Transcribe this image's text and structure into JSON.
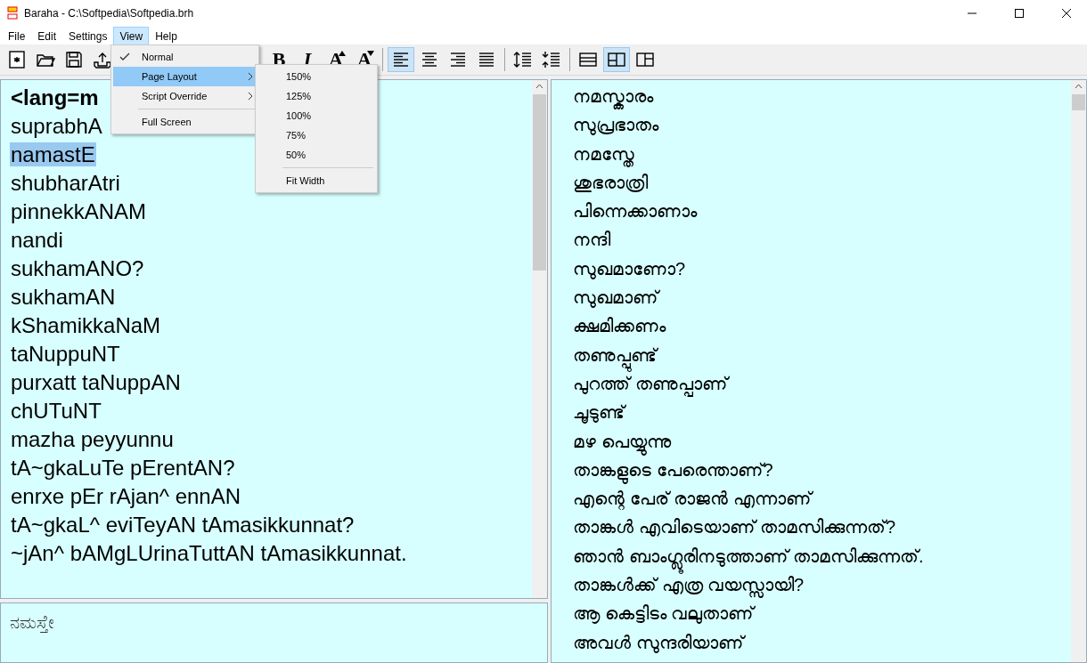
{
  "window": {
    "title": "Baraha - C:\\Softpedia\\Softpedia.brh"
  },
  "menu_bar": [
    {
      "label": "File",
      "selected": false
    },
    {
      "label": "Edit",
      "selected": false
    },
    {
      "label": "Settings",
      "selected": false
    },
    {
      "label": "View",
      "selected": true
    },
    {
      "label": "Help",
      "selected": false
    }
  ],
  "toolbar": [
    {
      "kind": "new",
      "selected": false
    },
    {
      "kind": "open",
      "selected": false
    },
    {
      "kind": "save",
      "selected": false
    },
    {
      "kind": "upload",
      "selected": false
    },
    {
      "kind": "gap"
    },
    {
      "kind": "bold",
      "label": "B",
      "selected": false
    },
    {
      "kind": "italic",
      "label": "I",
      "selected": false
    },
    {
      "kind": "grow",
      "label": "A",
      "selected": false
    },
    {
      "kind": "shrink",
      "label": "A",
      "selected": false
    },
    {
      "kind": "separator"
    },
    {
      "kind": "align-left",
      "selected": true
    },
    {
      "kind": "align-center",
      "selected": false
    },
    {
      "kind": "align-right",
      "selected": false
    },
    {
      "kind": "justify",
      "selected": false
    },
    {
      "kind": "separator"
    },
    {
      "kind": "spacing-up",
      "selected": false
    },
    {
      "kind": "spacing-down",
      "selected": false
    },
    {
      "kind": "separator"
    },
    {
      "kind": "layout-rows",
      "selected": false
    },
    {
      "kind": "layout-split",
      "selected": true
    },
    {
      "kind": "layout-columns",
      "selected": false
    }
  ],
  "view_menu": {
    "items": [
      {
        "label": "Normal",
        "checked": true,
        "selected": false,
        "submenu": false
      },
      {
        "label": "Page Layout",
        "checked": false,
        "selected": true,
        "submenu": true
      },
      {
        "label": "Script Override",
        "checked": false,
        "selected": false,
        "submenu": true
      },
      {
        "kind": "separator"
      },
      {
        "label": "Full Screen",
        "checked": false,
        "selected": false,
        "submenu": false
      }
    ],
    "page_layout_submenu": [
      {
        "label": "150%"
      },
      {
        "label": "125%"
      },
      {
        "label": "100%"
      },
      {
        "label": "75%"
      },
      {
        "label": "50%"
      },
      {
        "kind": "separator"
      },
      {
        "label": "Fit Width"
      }
    ]
  },
  "source_editor": {
    "lines": [
      {
        "text": "<lang=m",
        "bold": true,
        "selected": false
      },
      {
        "text": "suprabhA",
        "bold": false,
        "selected": false
      },
      {
        "text": "namastE",
        "bold": false,
        "selected": true
      },
      {
        "text": "shubharAtri",
        "bold": false,
        "selected": false
      },
      {
        "text": "pinnekkANAM",
        "bold": false,
        "selected": false
      },
      {
        "text": "nandi",
        "bold": false,
        "selected": false
      },
      {
        "text": "sukhamANO?",
        "bold": false,
        "selected": false
      },
      {
        "text": "sukhamAN",
        "bold": false,
        "selected": false
      },
      {
        "text": "kShamikkaNaM",
        "bold": false,
        "selected": false
      },
      {
        "text": "taNuppuNT",
        "bold": false,
        "selected": false
      },
      {
        "text": "purxatt taNuppAN",
        "bold": false,
        "selected": false
      },
      {
        "text": "chUTuNT",
        "bold": false,
        "selected": false
      },
      {
        "text": "mazha peyyunnu",
        "bold": false,
        "selected": false
      },
      {
        "text": "tA~gkaLuTe pErentAN?",
        "bold": false,
        "selected": false
      },
      {
        "text": "enrxe pEr rAjan^ ennAN",
        "bold": false,
        "selected": false
      },
      {
        "text": "tA~gkaL^ eviTeyAN tAmasikkunnat?",
        "bold": false,
        "selected": false
      },
      {
        "text": "~jAn^ bAMgLUrinaTuttAN tAmasikkunnat.",
        "bold": false,
        "selected": false
      }
    ]
  },
  "preview_box": {
    "text": "ನಮಸ್ತೇ"
  },
  "output_pane": {
    "lines": [
      "നമസ്കാരം",
      "സുപ്രഭാതം",
      "നമസ്തേ",
      "ശുഭരാത്രി",
      "പിന്നെക്കാണാം",
      "നന്ദി",
      "സുഖമാണോ?",
      "സുഖമാണ്",
      "ക്ഷമിക്കണം",
      "തണുപ്പുണ്ട്",
      "പുറത്ത് തണുപ്പാണ്",
      "ചൂടുണ്ട്",
      "മഴ പെയ്യുന്നു",
      "താങ്കളുടെ പേരെന്താണ്?",
      "എന്റെ പേര് രാജൻ എന്നാണ്",
      "താങ്കൾ എവിടെയാണ് താമസിക്കുന്നത്?",
      "ഞാൻ ബാംഗ്ലൂരിനടുത്താണ് താമസിക്കുന്നത്.",
      "താങ്കൾക്ക് എത്ര വയസ്സായി?",
      "ആ കെട്ടിടം വലുതാണ്",
      "അവൾ സുന്ദരിയാണ്"
    ]
  }
}
